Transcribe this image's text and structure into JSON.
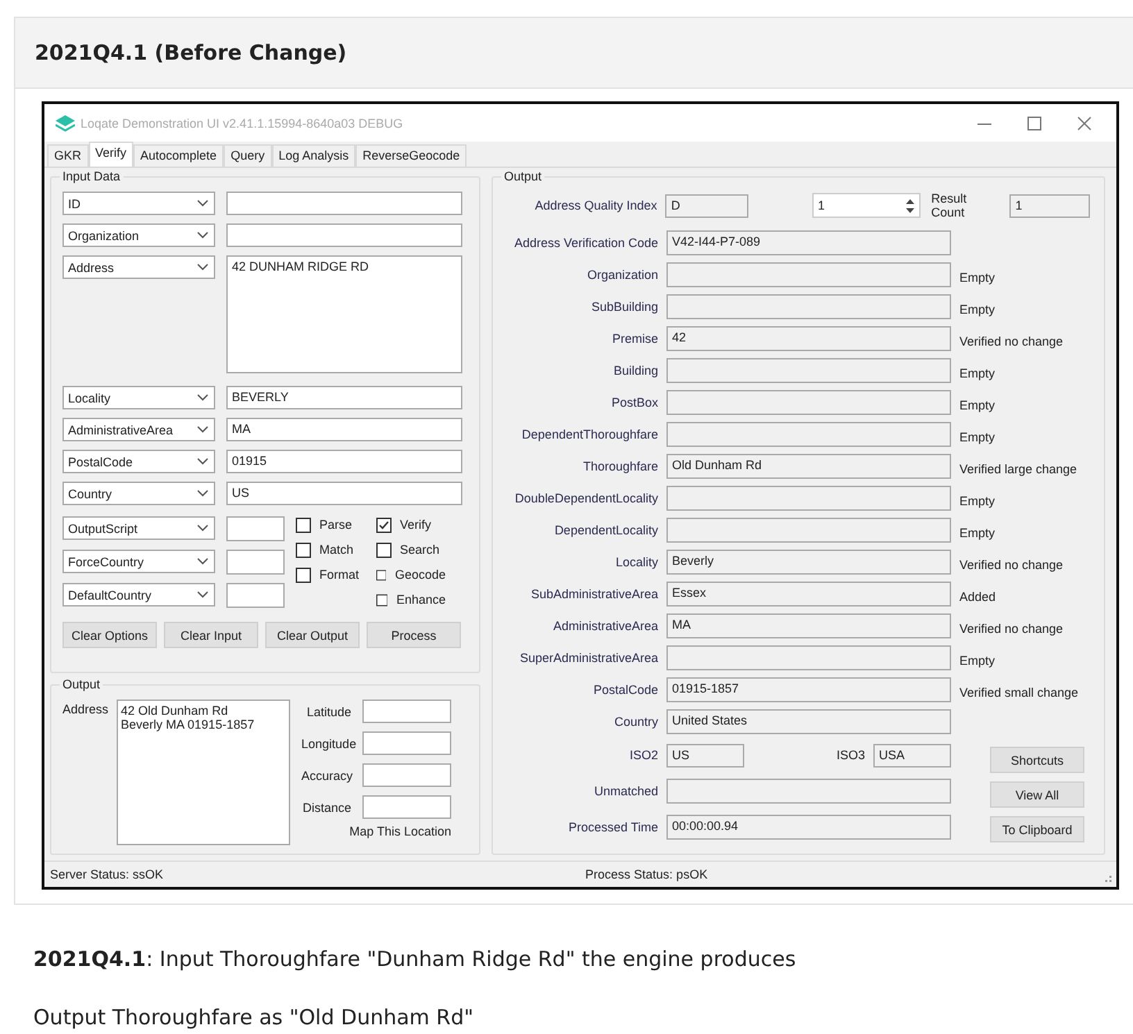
{
  "section_title": "2021Q4.1 (Before Change)",
  "window": {
    "title": "Loqate Demonstration UI v2.41.1.15994-8640a03  DEBUG"
  },
  "tabs": [
    {
      "label": "GKR",
      "selected": false
    },
    {
      "label": "Verify",
      "selected": true
    },
    {
      "label": "Autocomplete",
      "selected": false
    },
    {
      "label": "Query",
      "selected": false
    },
    {
      "label": "Log Analysis",
      "selected": false
    },
    {
      "label": "ReverseGeocode",
      "selected": false
    }
  ],
  "input_data": {
    "title": "Input Data",
    "rows": [
      {
        "kind": "line",
        "dropdown": "ID"
      },
      {
        "kind": "line",
        "dropdown": "Organization"
      },
      {
        "kind": "multiline",
        "dropdown": "Address",
        "value": "42 DUNHAM RIDGE RD"
      },
      {
        "kind": "line",
        "dropdown": "Locality",
        "value": "BEVERLY"
      },
      {
        "kind": "line",
        "dropdown": "AdministrativeArea",
        "value": "MA"
      },
      {
        "kind": "line",
        "dropdown": "PostalCode",
        "value": "01915"
      },
      {
        "kind": "line",
        "dropdown": "Country",
        "value": "US"
      }
    ],
    "options": [
      {
        "dropdown": "OutputScript"
      },
      {
        "dropdown": "ForceCountry"
      },
      {
        "dropdown": "DefaultCountry"
      }
    ],
    "checkbox_columns": [
      [
        {
          "label": "Parse",
          "checked": false
        },
        {
          "label": "Match",
          "checked": false
        },
        {
          "label": "Format",
          "checked": false
        }
      ],
      [
        {
          "label": "Verify",
          "checked": true
        },
        {
          "label": "Search",
          "checked": false
        },
        {
          "label": "Geocode",
          "checked": false
        },
        {
          "label": "Enhance",
          "checked": false
        }
      ]
    ],
    "buttons": [
      "Clear Options",
      "Clear Input",
      "Clear Output",
      "Process"
    ]
  },
  "mini_output": {
    "title": "Output",
    "address_label": "Address",
    "address_lines": [
      "42 Old Dunham Rd",
      "Beverly MA 01915-1857"
    ],
    "coords": [
      {
        "label": "Latitude"
      },
      {
        "label": "Longitude"
      },
      {
        "label": "Accuracy"
      },
      {
        "label": "Distance"
      }
    ],
    "map_link": "Map This Location"
  },
  "output": {
    "title": "Output",
    "quality_label": "Address Quality Index",
    "quality": "D",
    "spinner": "1",
    "result_count_label": "Result Count",
    "result_count": "1",
    "avc_label": "Address Verification Code",
    "avc": "V42-I44-P7-089",
    "fields": [
      {
        "label": "Organization",
        "status": "Empty"
      },
      {
        "label": "SubBuilding",
        "status": "Empty"
      },
      {
        "label": "Premise",
        "value": "42",
        "status": "Verified no change"
      },
      {
        "label": "Building",
        "status": "Empty"
      },
      {
        "label": "PostBox",
        "status": "Empty"
      },
      {
        "label": "DependentThoroughfare",
        "status": "Empty"
      },
      {
        "label": "Thoroughfare",
        "value": "Old Dunham Rd",
        "status": "Verified large change"
      },
      {
        "label": "DoubleDependentLocality",
        "status": "Empty"
      },
      {
        "label": "DependentLocality",
        "status": "Empty"
      },
      {
        "label": "Locality",
        "value": "Beverly",
        "status": "Verified no change"
      },
      {
        "label": "SubAdministrativeArea",
        "value": "Essex",
        "status": "Added"
      },
      {
        "label": "AdministrativeArea",
        "value": "MA",
        "status": "Verified no change"
      },
      {
        "label": "SuperAdministrativeArea",
        "status": "Empty"
      },
      {
        "label": "PostalCode",
        "value": "01915-1857",
        "status": "Verified small change"
      },
      {
        "label": "Country",
        "value": "United States"
      }
    ],
    "iso": [
      {
        "label": "ISO2",
        "value": "US"
      },
      {
        "label": "ISO3",
        "value": "USA"
      }
    ],
    "unmatched_label": "Unmatched",
    "processed_label": "Processed Time",
    "processed": "00:00:00.94",
    "buttons": [
      "Shortcuts",
      "View All",
      "To Clipboard"
    ]
  },
  "status_bar": {
    "server": "Server Status: ssOK",
    "process": "Process Status: psOK"
  },
  "caption": [
    "**2021Q4.1**: Input Thoroughfare \"Dunham Ridge Rd\" the engine produces",
    "Output Thoroughfare as \"Old Dunham Rd\""
  ]
}
